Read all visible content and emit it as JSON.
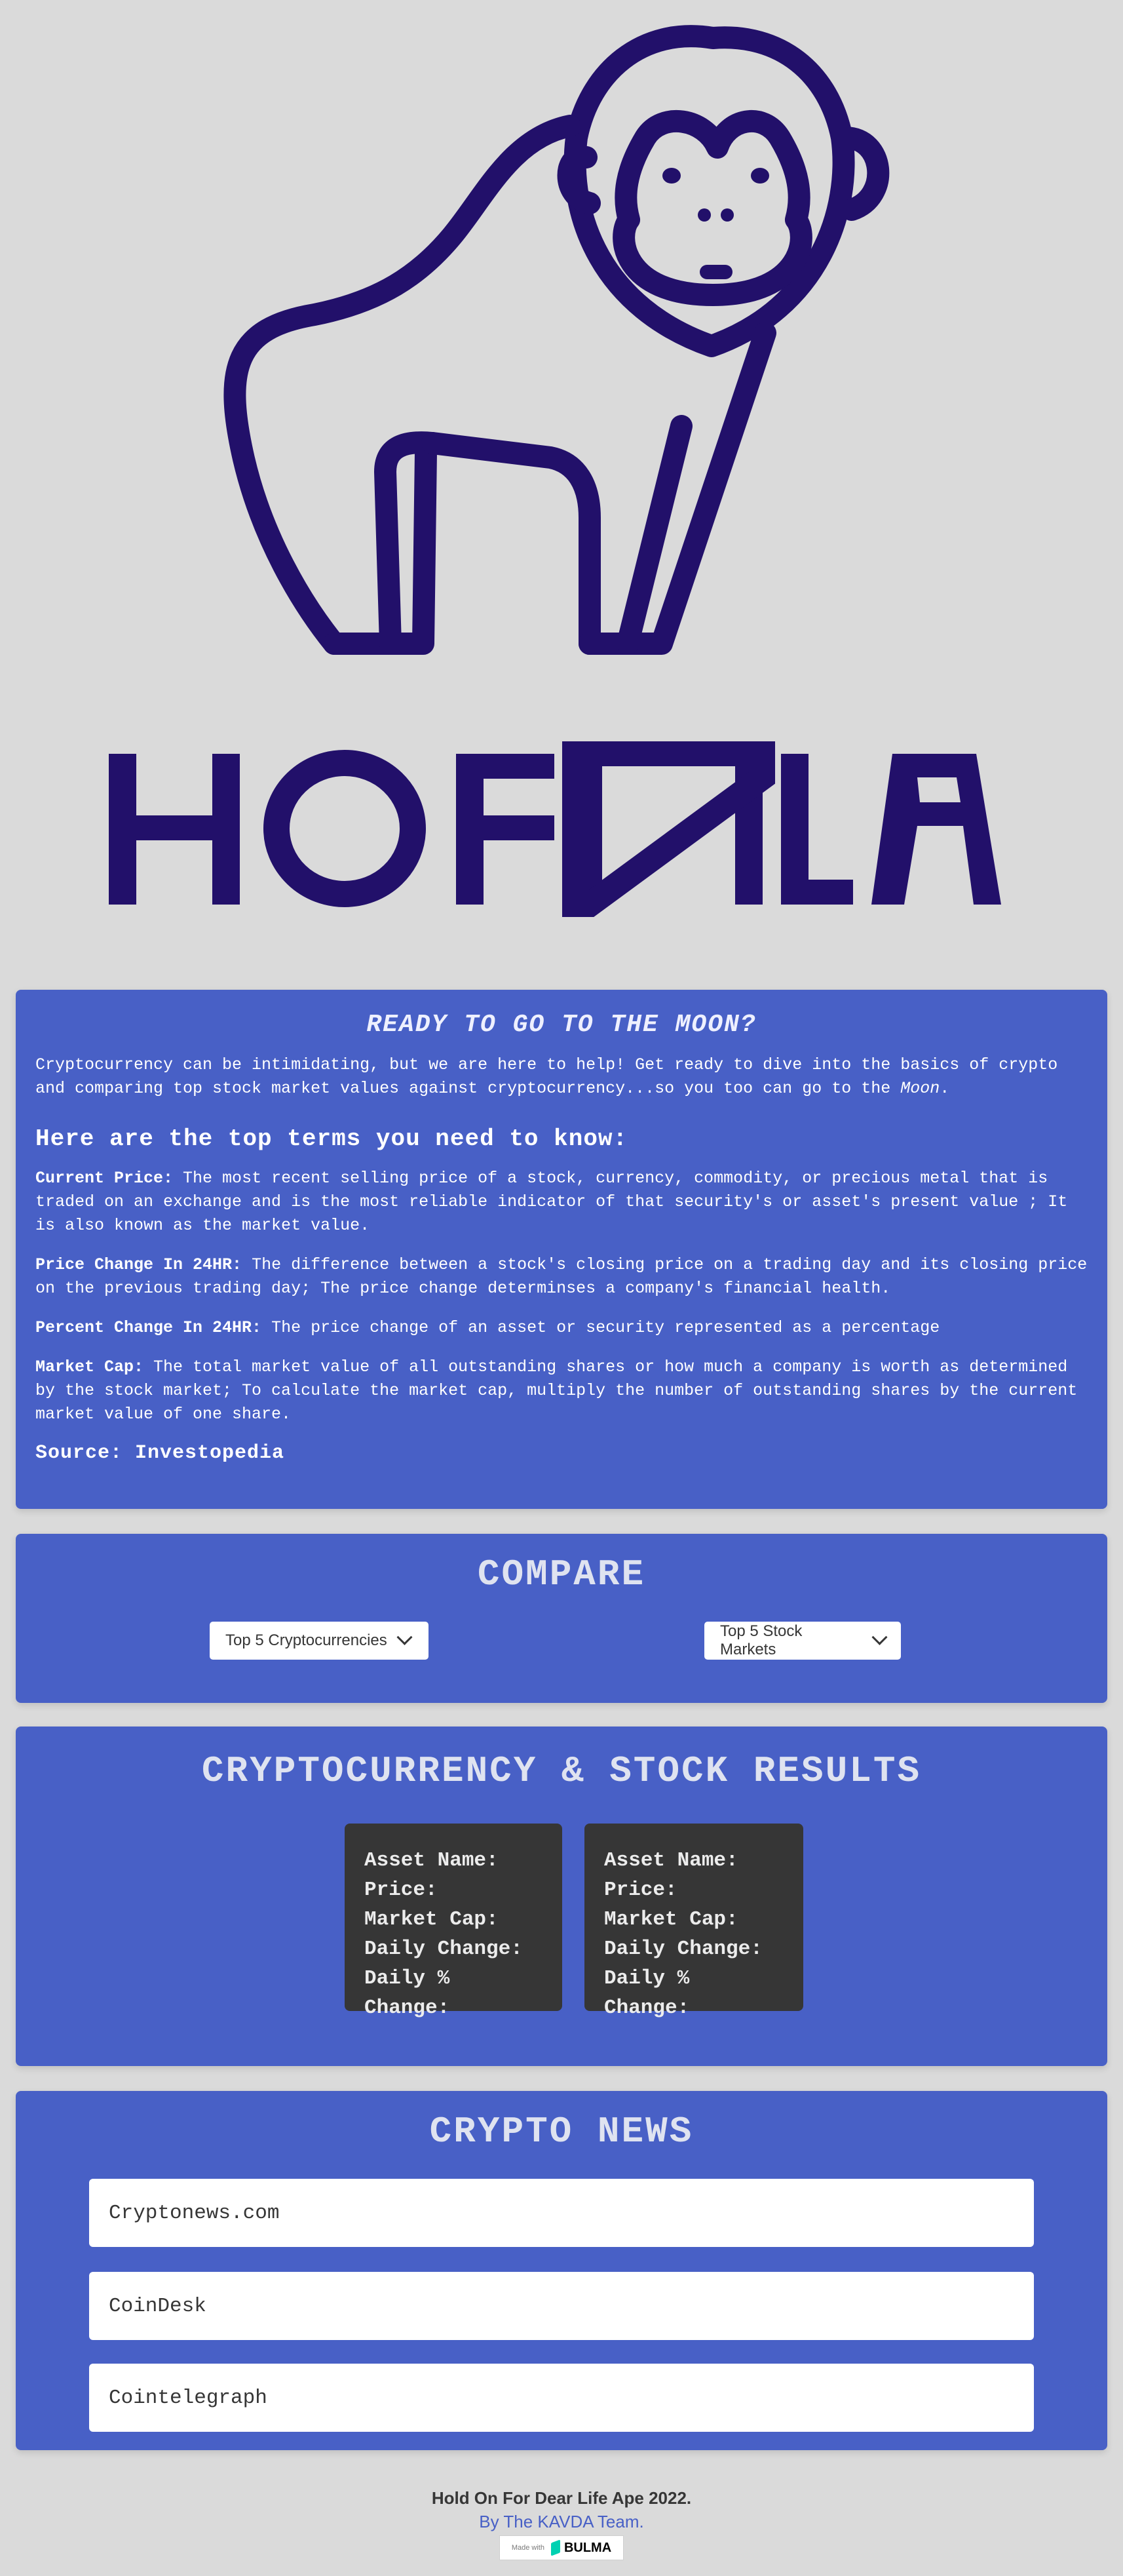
{
  "brand": {
    "logo_icon": "gorilla-icon",
    "logo_color": "#22106a",
    "wordmark": "HOFDLA"
  },
  "intro": {
    "title": "READY TO GO TO THE MOON?",
    "paragraph_text": "Cryptocurrency can be intimidating, but we are here to help! Get ready to dive into the basics of crypto and comparing top stock market values against cryptocurrency...so you too can go to the ",
    "paragraph_emphasis": "Moon",
    "paragraph_end": ".",
    "terms_heading": "Here are the top terms you need to know:",
    "terms": [
      {
        "term": "Current Price:",
        "definition": " The most recent selling price of a stock, currency, commodity, or precious metal that is traded on an exchange and is the most reliable indicator of that security's or asset's present value ; It is also known as the market value."
      },
      {
        "term": "Price Change In 24HR:",
        "definition": " The difference between a stock's closing price on a trading day and its closing price on the previous trading day; The price change determinses a company's financial health."
      },
      {
        "term": "Percent Change In 24HR:",
        "definition": " The price change of an asset or security represented as a percentage"
      },
      {
        "term": "Market Cap:",
        "definition": " The total market value of all outstanding shares or how much a company is worth as determined by the stock market; To calculate the market cap, multiply the number of outstanding shares by the current market value of one share."
      }
    ],
    "source": "Source: Investopedia"
  },
  "compare": {
    "title": "COMPARE",
    "crypto_select": "Top 5 Cryptocurrencies",
    "stock_select": "Top 5 Stock Markets",
    "chevron_icon": "chevron-down-icon"
  },
  "results": {
    "title": "CRYPTOCURRENCY & STOCK RESULTS",
    "cards": [
      {
        "asset_name": "Asset Name:",
        "price": "Price:",
        "market_cap": "Market Cap:",
        "daily_change": "Daily Change:",
        "daily_pct_change": "Daily % Change:"
      },
      {
        "asset_name": "Asset Name:",
        "price": "Price:",
        "market_cap": "Market Cap:",
        "daily_change": "Daily Change:",
        "daily_pct_change": "Daily % Change:"
      }
    ]
  },
  "news": {
    "title": "CRYPTO NEWS",
    "items": [
      "Cryptonews.com",
      "CoinDesk",
      "Cointelegraph"
    ]
  },
  "footer": {
    "line1": "Hold On For Dear Life Ape 2022.",
    "line2": "By The KAVDA Team.",
    "badge_made_with": "Made with",
    "badge_name": "BULMA"
  },
  "colors": {
    "background": "#dadada",
    "panel": "#4860c6",
    "card": "#363636",
    "accent_link": "#4860c6"
  }
}
